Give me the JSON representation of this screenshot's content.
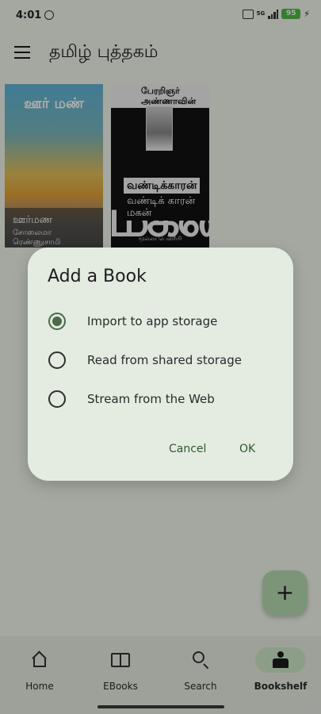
{
  "status_bar": {
    "time": "4:01",
    "network": "5G",
    "battery": "95"
  },
  "app_bar": {
    "title": "தமிழ் புத்தகம்"
  },
  "books": [
    {
      "cover_heading": "ஊர் மண்",
      "title": "ஊர்மண",
      "author": "சோலைமா ரெண்ணுசாமி"
    },
    {
      "cover_top": "பேரறிஞர் அண்ணாவின்",
      "cover_heading": "வண்டிக்காரன்",
      "cover_big": "மகன்",
      "title": "வண்டிக் காரன் மகன்",
      "publisher": "மூல்லா      பெஸரீயி"
    }
  ],
  "dialog": {
    "title": "Add a Book",
    "options": [
      {
        "label": "Import to app storage",
        "selected": true
      },
      {
        "label": "Read from shared storage",
        "selected": false
      },
      {
        "label": "Stream from the Web",
        "selected": false
      }
    ],
    "cancel_label": "Cancel",
    "ok_label": "OK"
  },
  "fab": {
    "icon": "plus-icon",
    "label": "+"
  },
  "bottom_nav": {
    "items": [
      {
        "label": "Home",
        "icon": "home-icon",
        "active": false
      },
      {
        "label": "EBooks",
        "icon": "book-open-icon",
        "active": false
      },
      {
        "label": "Search",
        "icon": "search-icon",
        "active": false
      },
      {
        "label": "Bookshelf",
        "icon": "bookshelf-reader-icon",
        "active": true
      }
    ]
  },
  "colors": {
    "accent": "#4b6a48",
    "nav_active_bg": "#cfe7c9",
    "fab_bg": "#b7dcb1",
    "dialog_bg": "#e4ebe1"
  }
}
